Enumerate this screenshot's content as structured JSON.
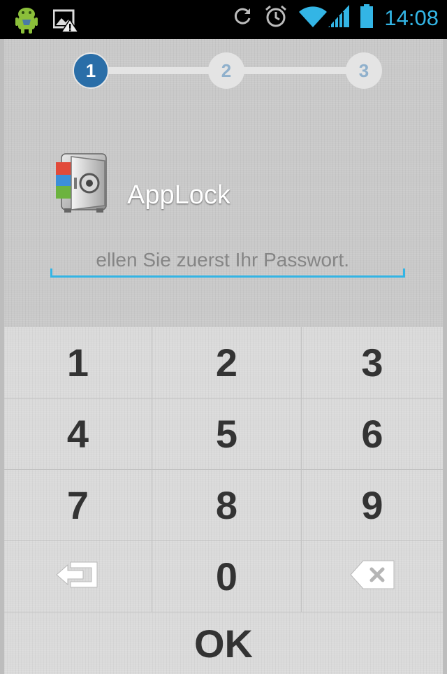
{
  "status_bar": {
    "time": "14:08",
    "left_icons": [
      "android-icon",
      "image-warning-icon"
    ],
    "right_icons": [
      "sync-icon",
      "alarm-icon",
      "wifi-icon",
      "signal-icon",
      "battery-icon"
    ]
  },
  "stepper": {
    "steps": [
      "1",
      "2",
      "3"
    ],
    "active_step": 1,
    "active_color": "#2a6ea8",
    "inactive_color": "#8fb0cc"
  },
  "app": {
    "title": "AppLock",
    "logo_icon": "safe-vault-icon"
  },
  "password": {
    "visible_text": "ellen Sie zuerst Ihr Passwort.",
    "accent_color": "#33b5e5"
  },
  "keypad": {
    "keys": [
      "1",
      "2",
      "3",
      "4",
      "5",
      "6",
      "7",
      "8",
      "9"
    ],
    "bottom_left_icon": "exit-back-icon",
    "zero": "0",
    "bottom_right_icon": "backspace-icon",
    "ok": "OK"
  }
}
